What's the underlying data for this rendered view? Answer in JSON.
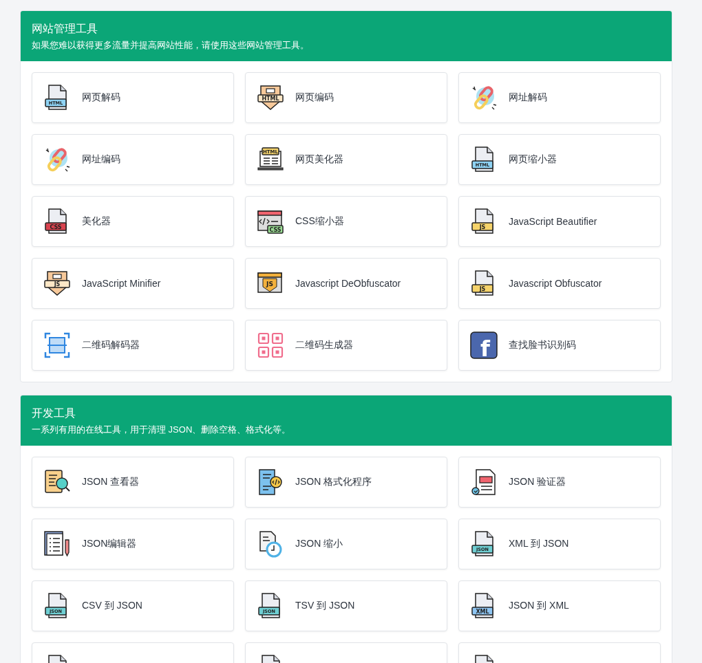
{
  "sections": [
    {
      "title": "网站管理工具",
      "subtitle": "如果您难以获得更多流量并提高网站性能，请使用这些网站管理工具。",
      "tools": [
        {
          "label": "网页解码",
          "icon": {
            "kind": "file",
            "badge": "HTML"
          }
        },
        {
          "label": "网页编码",
          "icon": {
            "kind": "shield",
            "badge": "HTML"
          }
        },
        {
          "label": "网址解码",
          "icon": {
            "kind": "link"
          }
        },
        {
          "label": "网址编码",
          "icon": {
            "kind": "link"
          }
        },
        {
          "label": "网页美化器",
          "icon": {
            "kind": "laptop",
            "badge": "HTML"
          }
        },
        {
          "label": "网页缩小器",
          "icon": {
            "kind": "file",
            "badge": "HTML"
          }
        },
        {
          "label": "美化器",
          "icon": {
            "kind": "file",
            "badge": "CSS"
          }
        },
        {
          "label": "CSS缩小器",
          "icon": {
            "kind": "browser",
            "badge": "CSS"
          }
        },
        {
          "label": "JavaScript Beautifier",
          "icon": {
            "kind": "file",
            "badge": "JS"
          }
        },
        {
          "label": "JavaScript Minifier",
          "icon": {
            "kind": "shield",
            "badge": "JS"
          }
        },
        {
          "label": "Javascript DeObfuscator",
          "icon": {
            "kind": "browser",
            "badge": "JS"
          }
        },
        {
          "label": "Javascript Obfuscator",
          "icon": {
            "kind": "file",
            "badge": "JS"
          }
        },
        {
          "label": "二维码解码器",
          "icon": {
            "kind": "scan"
          }
        },
        {
          "label": "二维码生成器",
          "icon": {
            "kind": "qr"
          }
        },
        {
          "label": "查找脸书识别码",
          "icon": {
            "kind": "logo",
            "badge": "f"
          }
        }
      ]
    },
    {
      "title": "开发工具",
      "subtitle": "一系列有用的在线工具，用于清理 JSON、删除空格、格式化等。",
      "tools": [
        {
          "label": "JSON 查看器",
          "icon": {
            "kind": "search-doc"
          }
        },
        {
          "label": "JSON 格式化程序",
          "icon": {
            "kind": "code-doc"
          }
        },
        {
          "label": "JSON 验证器",
          "icon": {
            "kind": "form-doc"
          }
        },
        {
          "label": "JSON编辑器",
          "icon": {
            "kind": "list-doc"
          }
        },
        {
          "label": "JSON 缩小",
          "icon": {
            "kind": "clock-doc"
          }
        },
        {
          "label": "XML 到 JSON",
          "icon": {
            "kind": "file",
            "badge": "JSON"
          }
        },
        {
          "label": "CSV 到 JSON",
          "icon": {
            "kind": "file",
            "badge": "JSON"
          }
        },
        {
          "label": "TSV 到 JSON",
          "icon": {
            "kind": "file",
            "badge": "JSON"
          }
        },
        {
          "label": "JSON 到 XML",
          "icon": {
            "kind": "file",
            "badge": "XML"
          }
        },
        {
          "icon": {
            "kind": "file"
          }
        },
        {
          "icon": {
            "kind": "file"
          }
        },
        {
          "icon": {
            "kind": "file"
          }
        }
      ]
    }
  ]
}
